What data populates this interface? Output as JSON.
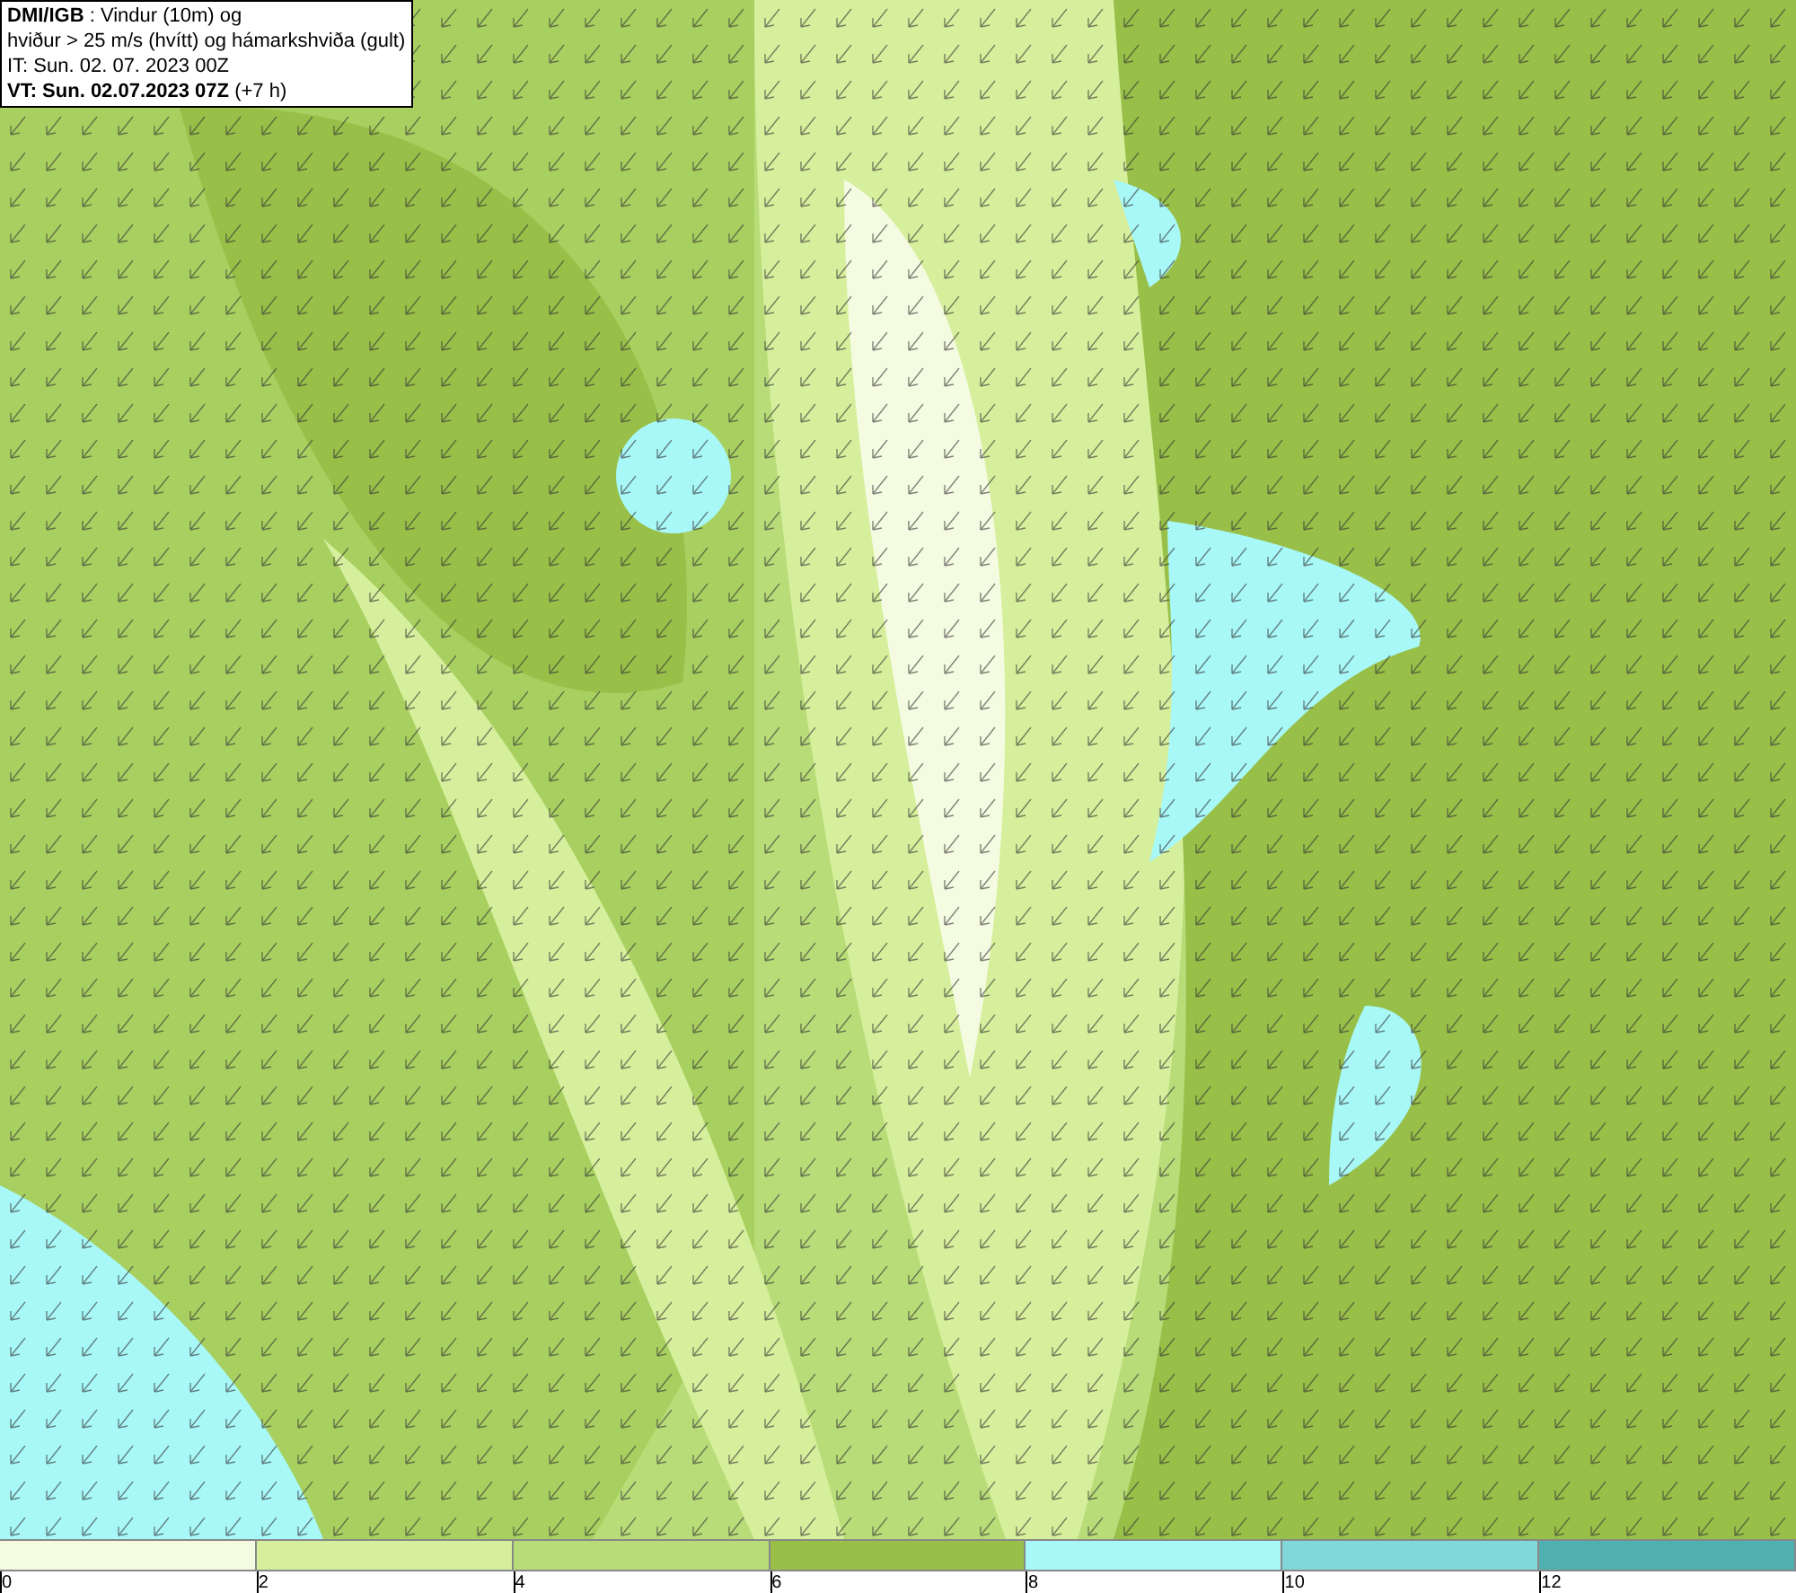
{
  "legend": {
    "lines": [
      "**DMI/IGB** : Vindur (10m) og",
      "hviður > 25 m/s (hvítt) og hámarkshviða (gult)",
      "IT: Sun. 02. 07. 2023 00Z",
      "**VT: Sun. 02.07.2023 07Z** (+7 h)"
    ]
  },
  "colorbar": {
    "segments": [
      {
        "color": "#f4fbe0"
      },
      {
        "color": "#d6ef9c"
      },
      {
        "color": "#b8dc78"
      },
      {
        "color": "#98bf48"
      },
      {
        "color": "#a8f8f8"
      },
      {
        "color": "#80d8d8"
      },
      {
        "color": "#50b0b0"
      }
    ],
    "ticks": [
      "0",
      "2",
      "4",
      "6",
      "8",
      "10",
      "12"
    ]
  }
}
